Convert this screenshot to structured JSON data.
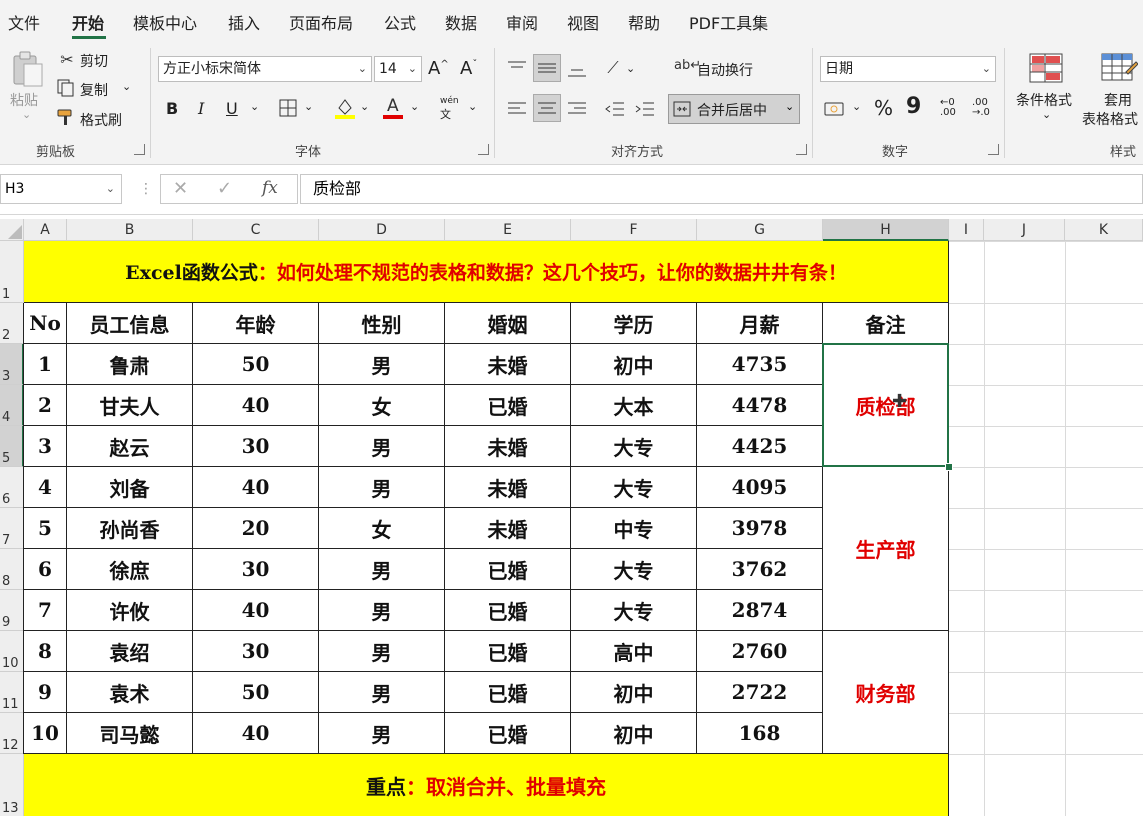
{
  "menu": {
    "tabs": [
      "文件",
      "开始",
      "模板中心",
      "插入",
      "页面布局",
      "公式",
      "数据",
      "审阅",
      "视图",
      "帮助",
      "PDF工具集"
    ],
    "active": "开始"
  },
  "ribbon": {
    "clipboard": {
      "paste": "粘贴",
      "cut": "剪切",
      "copy": "复制",
      "format_painter": "格式刷",
      "group": "剪贴板"
    },
    "font": {
      "name": "方正小标宋简体",
      "size": "14",
      "group": "字体",
      "bold": "B",
      "italic": "I",
      "underline": "U",
      "font_color_glyph": "A",
      "wen": "wén",
      "wen_char": "文"
    },
    "align": {
      "wrap": "自动换行",
      "merge": "合并后居中",
      "group": "对齐方式"
    },
    "number": {
      "format": "日期",
      "percent": "%",
      "comma": "9",
      "group": "数字"
    },
    "styles": {
      "conditional": "条件格式",
      "table_format_1": "套用",
      "table_format_2": "表格格式",
      "group": "样式"
    }
  },
  "formula_bar": {
    "name_box": "H3",
    "fx": "fx",
    "content": "质检部"
  },
  "columns": [
    "A",
    "B",
    "C",
    "D",
    "E",
    "F",
    "G",
    "H",
    "I",
    "J",
    "K"
  ],
  "rows": [
    "1",
    "2",
    "3",
    "4",
    "5",
    "6",
    "7",
    "8",
    "9",
    "10",
    "11",
    "12",
    "13"
  ],
  "sheet": {
    "title_black": "Excel函数公式",
    "title_red": "：如何处理不规范的表格和数据？这几个技巧，让你的数据井井有条！",
    "headers": [
      "No",
      "员工信息",
      "年龄",
      "性别",
      "婚姻",
      "学历",
      "月薪",
      "备注"
    ],
    "data": [
      [
        "1",
        "鲁肃",
        "50",
        "男",
        "未婚",
        "初中",
        "4735"
      ],
      [
        "2",
        "甘夫人",
        "40",
        "女",
        "已婚",
        "大本",
        "4478"
      ],
      [
        "3",
        "赵云",
        "30",
        "男",
        "未婚",
        "大专",
        "4425"
      ],
      [
        "4",
        "刘备",
        "40",
        "男",
        "未婚",
        "大专",
        "4095"
      ],
      [
        "5",
        "孙尚香",
        "20",
        "女",
        "未婚",
        "中专",
        "3978"
      ],
      [
        "6",
        "徐庶",
        "30",
        "男",
        "已婚",
        "大专",
        "3762"
      ],
      [
        "7",
        "许攸",
        "40",
        "男",
        "已婚",
        "大专",
        "2874"
      ],
      [
        "8",
        "袁绍",
        "30",
        "男",
        "已婚",
        "高中",
        "2760"
      ],
      [
        "9",
        "袁术",
        "50",
        "男",
        "已婚",
        "初中",
        "2722"
      ],
      [
        "10",
        "司马懿",
        "40",
        "男",
        "已婚",
        "初中",
        "168"
      ]
    ],
    "notes": [
      "质检部",
      "生产部",
      "财务部"
    ],
    "footer_black": "重点",
    "footer_red": "：取消合并、批量填充"
  },
  "colors": {
    "accent": "#217346",
    "yellow": "#ffff00",
    "red": "#e00000"
  }
}
